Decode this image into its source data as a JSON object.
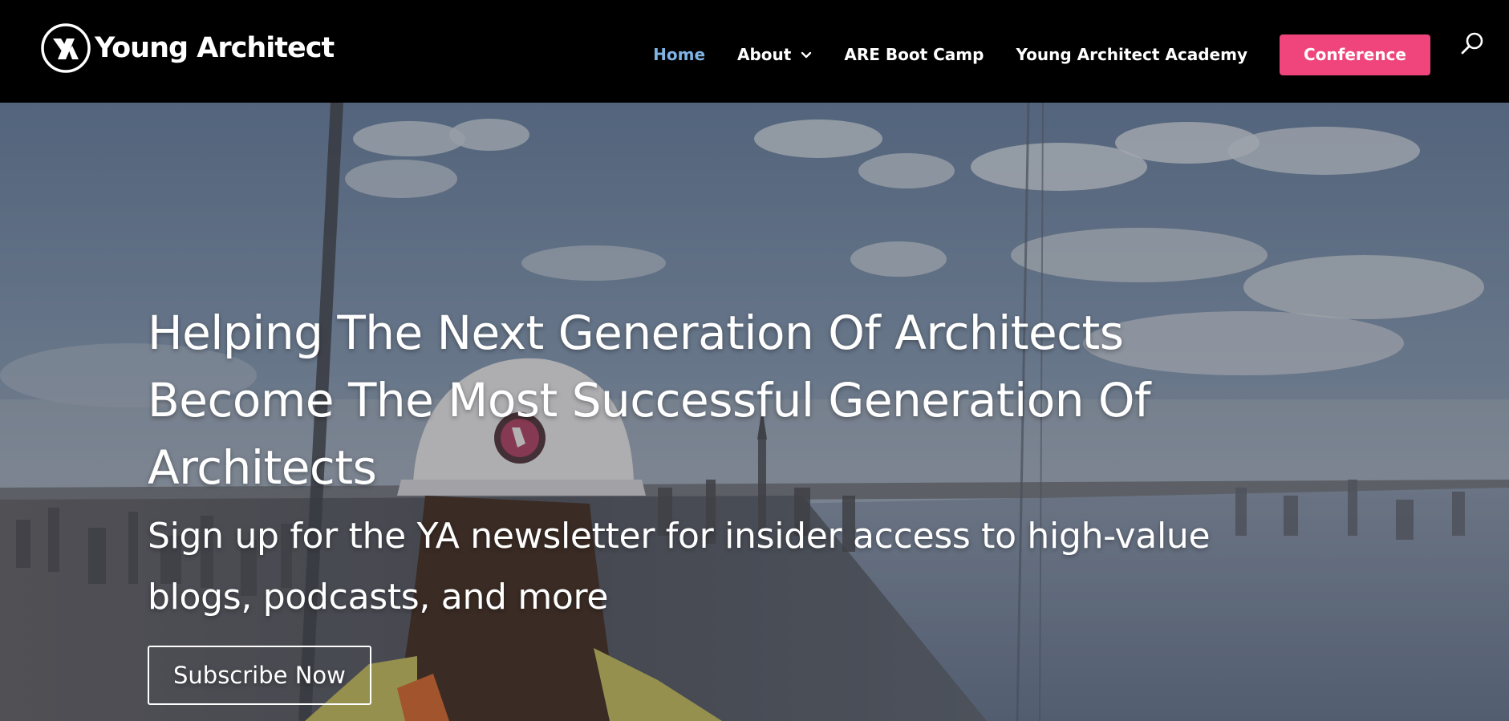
{
  "brand": {
    "name": "Young Architect",
    "logo_icon": "ya-logo-icon"
  },
  "nav": {
    "items": [
      {
        "label": "Home",
        "active": true
      },
      {
        "label": "About",
        "has_dropdown": true
      },
      {
        "label": "ARE Boot Camp"
      },
      {
        "label": "Young Architect Academy"
      }
    ],
    "cta_label": "Conference",
    "cta_color": "#f0457c",
    "active_color": "#7fb3e3",
    "search_icon": "search-icon"
  },
  "hero": {
    "title": "Helping The Next Generation Of Architects Become The Most Successful Generation Of Architects",
    "subtitle": "Sign up for the YA newsletter for insider access to high-value blogs, podcasts, and more",
    "button_label": "Subscribe Now"
  }
}
